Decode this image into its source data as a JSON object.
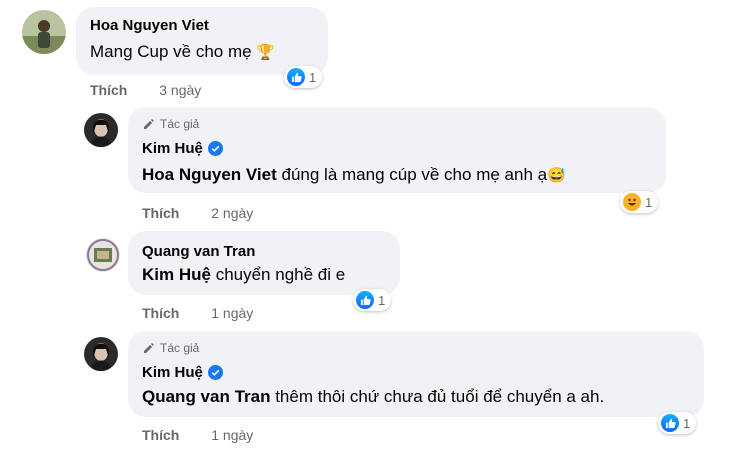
{
  "comments": [
    {
      "author": "Hoa Nguyen Viet",
      "text": "Mang Cup về cho mẹ",
      "trophy": "🏆",
      "reaction_count": "1",
      "like_label": "Thích",
      "time": "3 ngày"
    },
    {
      "author_tag": "Tác giả",
      "author": "Kim Huệ",
      "mention": "Hoa Nguyen Viet",
      "text": " đúng là mang cúp về cho mẹ anh ạ",
      "emoji": "😅",
      "reaction_count": "1",
      "like_label": "Thích",
      "time": "2 ngày"
    },
    {
      "author": "Quang van Tran",
      "mention": "Kim Huệ",
      "text": " chuyển nghề đi e",
      "reaction_count": "1",
      "like_label": "Thích",
      "time": "1 ngày"
    },
    {
      "author_tag": "Tác giả",
      "author": "Kim Huệ",
      "mention": "Quang van Tran",
      "text": " thêm thôi chứ chưa đủ tuổi để chuyển a ah.",
      "reaction_count": "1",
      "like_label": "Thích",
      "time": "1 ngày"
    }
  ],
  "colors": {
    "bubble": "#f0f2f5",
    "meta": "#65676b",
    "like_blue": "#0866ff",
    "verified": "#1877f2"
  },
  "icons": [
    "like-reaction-icon",
    "haha-reaction-icon",
    "verified-badge-icon",
    "pencil-icon",
    "trophy-icon"
  ]
}
